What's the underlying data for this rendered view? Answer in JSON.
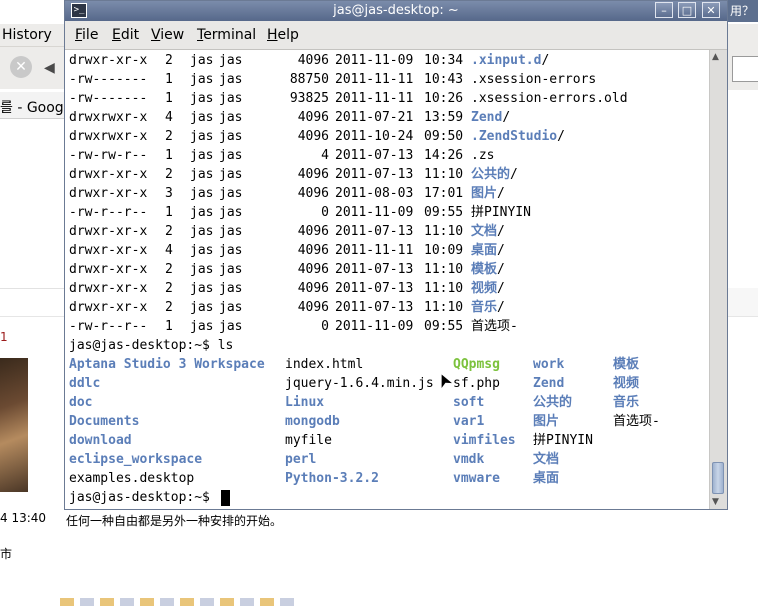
{
  "background_window": {
    "title_tail": "用？ -",
    "menu_history": "History",
    "tab_label": "를 - Google",
    "time_text": "4 13:40",
    "quote_text": "任何一种自由都是另外一种安排的开始。",
    "city_text": "市",
    "red_mark": "1"
  },
  "terminal": {
    "title": "jas@jas-desktop: ~",
    "menu": [
      {
        "label": "File",
        "accel": "F",
        "rest": "ile"
      },
      {
        "label": "Edit",
        "accel": "E",
        "rest": "dit"
      },
      {
        "label": "View",
        "accel": "V",
        "rest": "iew"
      },
      {
        "label": "Terminal",
        "accel": "T",
        "rest": "erminal"
      },
      {
        "label": "Help",
        "accel": "H",
        "rest": "elp"
      }
    ],
    "buttons": {
      "minimize": "–",
      "maximize": "□",
      "close": "✕"
    },
    "listing": [
      {
        "perm": "drwxr-xr-x",
        "links": "2",
        "user": "jas",
        "group": "jas",
        "size": "4096",
        "date": "2011-11-09",
        "time": "10:34",
        "name": ".xinput.d",
        "suffix": "/",
        "kind": "dir"
      },
      {
        "perm": "-rw-------",
        "links": "1",
        "user": "jas",
        "group": "jas",
        "size": "88750",
        "date": "2011-11-11",
        "time": "10:43",
        "name": ".xsession-errors",
        "suffix": "",
        "kind": "plain"
      },
      {
        "perm": "-rw-------",
        "links": "1",
        "user": "jas",
        "group": "jas",
        "size": "93825",
        "date": "2011-11-11",
        "time": "10:26",
        "name": ".xsession-errors.old",
        "suffix": "",
        "kind": "plain"
      },
      {
        "perm": "drwxrwxr-x",
        "links": "4",
        "user": "jas",
        "group": "jas",
        "size": "4096",
        "date": "2011-07-21",
        "time": "13:59",
        "name": "Zend",
        "suffix": "/",
        "kind": "dir"
      },
      {
        "perm": "drwxrwxr-x",
        "links": "2",
        "user": "jas",
        "group": "jas",
        "size": "4096",
        "date": "2011-10-24",
        "time": "09:50",
        "name": ".ZendStudio",
        "suffix": "/",
        "kind": "dir"
      },
      {
        "perm": "-rw-rw-r--",
        "links": "1",
        "user": "jas",
        "group": "jas",
        "size": "4",
        "date": "2011-07-13",
        "time": "14:26",
        "name": ".zs",
        "suffix": "",
        "kind": "plain"
      },
      {
        "perm": "drwxr-xr-x",
        "links": "2",
        "user": "jas",
        "group": "jas",
        "size": "4096",
        "date": "2011-07-13",
        "time": "11:10",
        "name": "公共的",
        "suffix": "/",
        "kind": "dir"
      },
      {
        "perm": "drwxr-xr-x",
        "links": "3",
        "user": "jas",
        "group": "jas",
        "size": "4096",
        "date": "2011-08-03",
        "time": "17:01",
        "name": "图片",
        "suffix": "/",
        "kind": "dir"
      },
      {
        "perm": "-rw-r--r--",
        "links": "1",
        "user": "jas",
        "group": "jas",
        "size": "0",
        "date": "2011-11-09",
        "time": "09:55",
        "name": "拼PINYIN",
        "suffix": "",
        "kind": "plain"
      },
      {
        "perm": "drwxr-xr-x",
        "links": "2",
        "user": "jas",
        "group": "jas",
        "size": "4096",
        "date": "2011-07-13",
        "time": "11:10",
        "name": "文档",
        "suffix": "/",
        "kind": "dir"
      },
      {
        "perm": "drwxr-xr-x",
        "links": "4",
        "user": "jas",
        "group": "jas",
        "size": "4096",
        "date": "2011-11-11",
        "time": "10:09",
        "name": "桌面",
        "suffix": "/",
        "kind": "dir"
      },
      {
        "perm": "drwxr-xr-x",
        "links": "2",
        "user": "jas",
        "group": "jas",
        "size": "4096",
        "date": "2011-07-13",
        "time": "11:10",
        "name": "模板",
        "suffix": "/",
        "kind": "dir"
      },
      {
        "perm": "drwxr-xr-x",
        "links": "2",
        "user": "jas",
        "group": "jas",
        "size": "4096",
        "date": "2011-07-13",
        "time": "11:10",
        "name": "视频",
        "suffix": "/",
        "kind": "dir"
      },
      {
        "perm": "drwxr-xr-x",
        "links": "2",
        "user": "jas",
        "group": "jas",
        "size": "4096",
        "date": "2011-07-13",
        "time": "11:10",
        "name": "音乐",
        "suffix": "/",
        "kind": "dir"
      },
      {
        "perm": "-rw-r--r--",
        "links": "1",
        "user": "jas",
        "group": "jas",
        "size": "0",
        "date": "2011-11-09",
        "time": "09:55",
        "name": "首选项-",
        "suffix": "",
        "kind": "plain"
      }
    ],
    "prompt_ls": "jas@jas-desktop:~$ ls",
    "ls_columns": [
      [
        {
          "name": "Aptana Studio 3 Workspace",
          "kind": "dir"
        },
        {
          "name": "ddlc",
          "kind": "dir"
        },
        {
          "name": "doc",
          "kind": "dir"
        },
        {
          "name": "Documents",
          "kind": "dir"
        },
        {
          "name": "download",
          "kind": "dir"
        },
        {
          "name": "eclipse_workspace",
          "kind": "dir"
        },
        {
          "name": "examples.desktop",
          "kind": "plain"
        }
      ],
      [
        {
          "name": "index.html",
          "kind": "plain"
        },
        {
          "name": "jquery-1.6.4.min.js",
          "kind": "plain"
        },
        {
          "name": "Linux",
          "kind": "dir"
        },
        {
          "name": "mongodb",
          "kind": "dir"
        },
        {
          "name": "myfile",
          "kind": "plain"
        },
        {
          "name": "perl",
          "kind": "dir"
        },
        {
          "name": "Python-3.2.2",
          "kind": "dir"
        }
      ],
      [
        {
          "name": "QQpmsg",
          "kind": "exe"
        },
        {
          "name": "sf.php",
          "kind": "plain"
        },
        {
          "name": "soft",
          "kind": "dir"
        },
        {
          "name": "var1",
          "kind": "dir"
        },
        {
          "name": "vimfiles",
          "kind": "dir"
        },
        {
          "name": "vmdk",
          "kind": "dir"
        },
        {
          "name": "vmware",
          "kind": "dir"
        }
      ],
      [
        {
          "name": "work",
          "kind": "dir"
        },
        {
          "name": "Zend",
          "kind": "dir"
        },
        {
          "name": "公共的",
          "kind": "dir"
        },
        {
          "name": "图片",
          "kind": "dir"
        },
        {
          "name": "拼PINYIN",
          "kind": "plain"
        },
        {
          "name": "文档",
          "kind": "dir"
        },
        {
          "name": "桌面",
          "kind": "dir"
        }
      ],
      [
        {
          "name": "模板",
          "kind": "dir"
        },
        {
          "name": "视频",
          "kind": "dir"
        },
        {
          "name": "音乐",
          "kind": "dir"
        },
        {
          "name": "首选项-",
          "kind": "plain"
        }
      ]
    ],
    "prompt_final": "jas@jas-desktop:~$ ",
    "colors": {
      "dir": "#5b7eb8",
      "exe": "#7cc23d",
      "text": "#000000",
      "titlebar": "#56688a"
    }
  }
}
